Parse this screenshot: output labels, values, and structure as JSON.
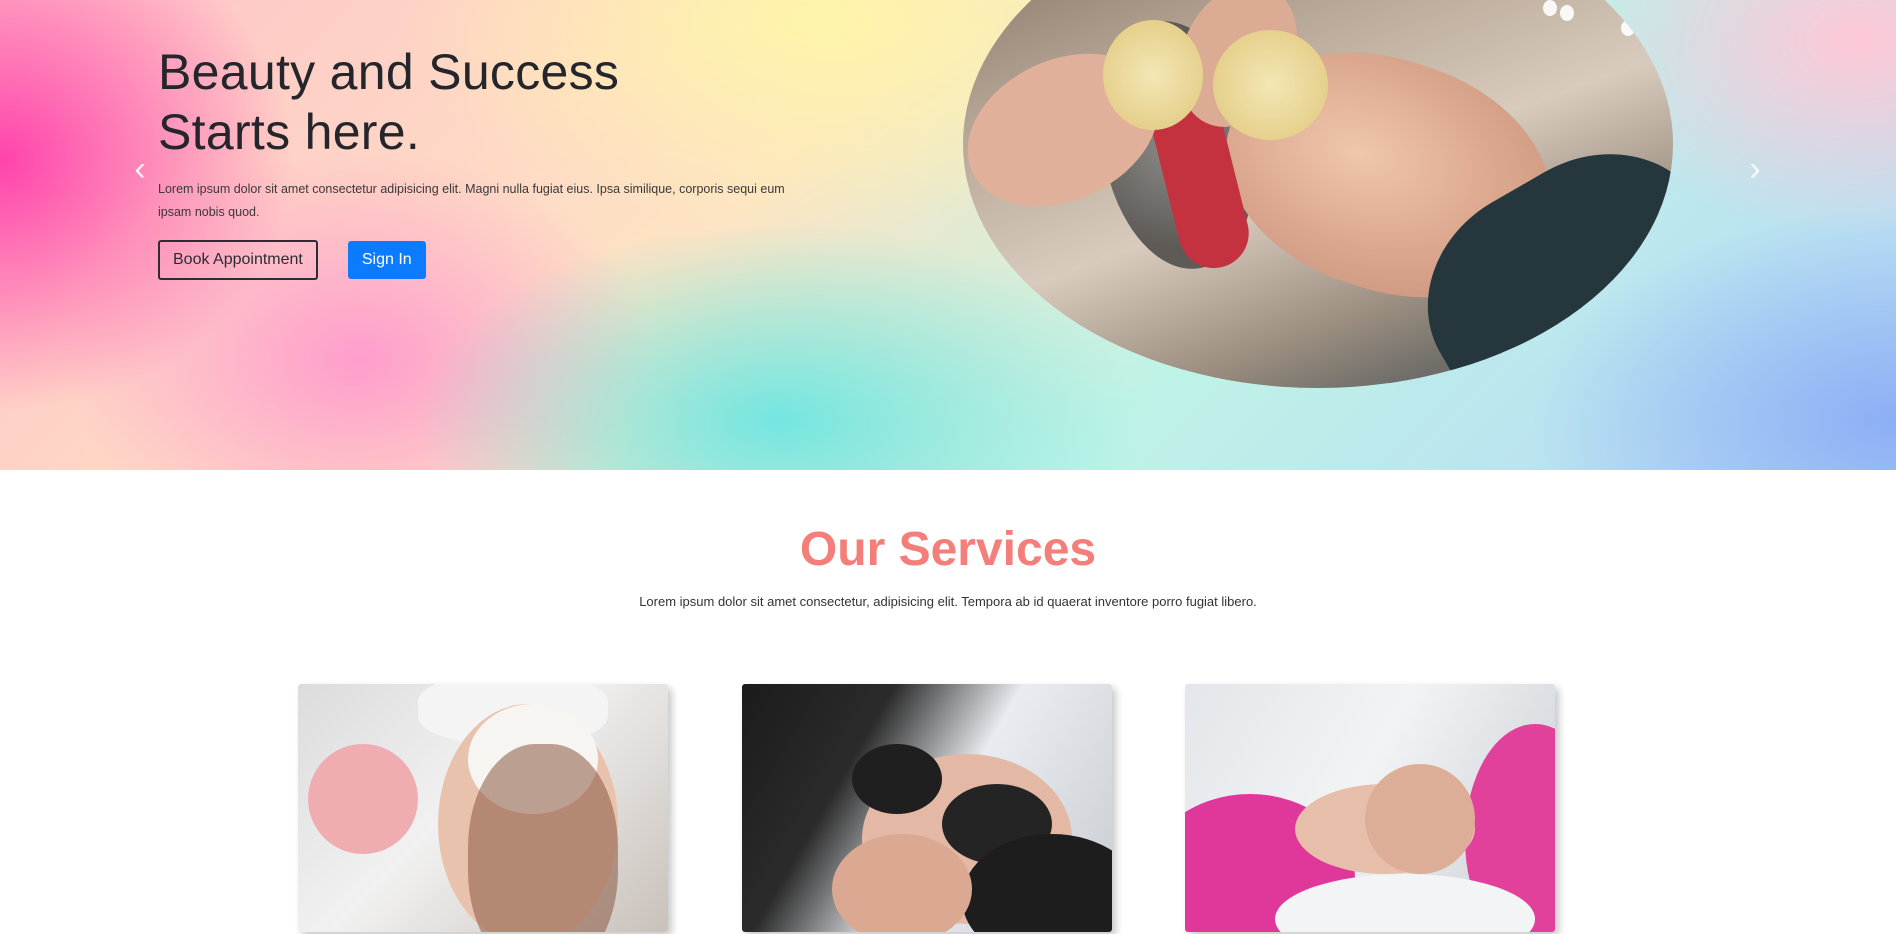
{
  "hero": {
    "title_line1": "Beauty and Success",
    "title_line2": "Starts here.",
    "description": "Lorem ipsum dolor sit amet consectetur adipisicing elit. Magni nulla fugiat eius. Ipsa similique, corporis sequi eum ipsam nobis quod.",
    "book_button": "Book Appointment",
    "signin_button": "Sign In",
    "prev_icon": "chevron-left-icon",
    "next_icon": "chevron-right-icon"
  },
  "services": {
    "title": "Our Services",
    "description": "Lorem ipsum dolor sit amet consectetur, adipisicing elit. Tempora ab id quaerat inventore porro fugiat libero."
  },
  "colors": {
    "services_title": "#f47e7a",
    "primary_button": "#0d7bff",
    "heading": "#24262c"
  }
}
